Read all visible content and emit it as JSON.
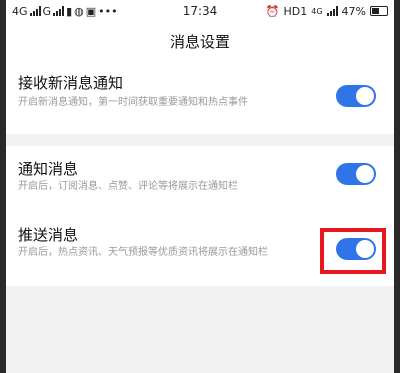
{
  "status_bar": {
    "carrier_1": "4G",
    "carrier_2": "G",
    "time": "17:34",
    "hd_label": "HD1",
    "network_label": "4G",
    "battery": "47%"
  },
  "header": {
    "title": "消息设置"
  },
  "settings": [
    {
      "title": "接收新消息通知",
      "desc": "开启新消息通知，第一时间获取重要通知和热点事件",
      "enabled": true
    },
    {
      "title": "通知消息",
      "desc": "开启后，订阅消息、点赞、评论等将展示在通知栏",
      "enabled": true
    },
    {
      "title": "推送消息",
      "desc": "开启后，热点资讯、天气预报等优质资讯将展示在通知栏",
      "enabled": true
    }
  ],
  "colors": {
    "toggle_on": "#2f74e8",
    "highlight": "#e8161e",
    "background": "#f2f2f2"
  }
}
